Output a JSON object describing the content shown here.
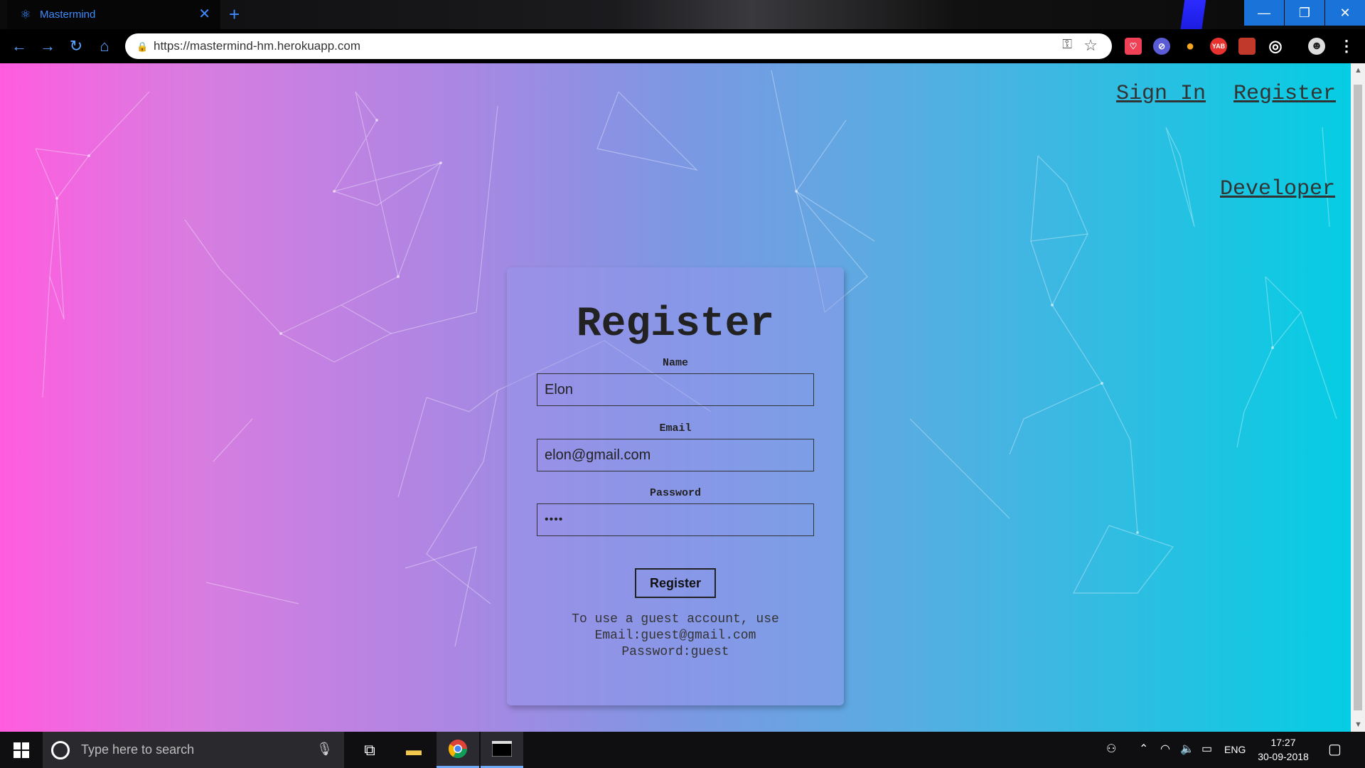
{
  "browser": {
    "tab_title": "Mastermind",
    "tab_close": "✕",
    "new_tab": "+",
    "url": "https://mastermind-hm.herokuapp.com",
    "window_controls": {
      "minimize": "—",
      "restore": "❐",
      "close": "✕"
    },
    "nav": {
      "back": "←",
      "forward": "→",
      "reload": "↻",
      "home": "⌂"
    },
    "extensions": [
      {
        "name": "pocket-icon",
        "glyph": "♡",
        "color": "#ef4056"
      },
      {
        "name": "block-icon",
        "glyph": "⊘",
        "color": "#5b5bd6"
      },
      {
        "name": "bulb-icon",
        "glyph": "●",
        "color": "#f5a623"
      },
      {
        "name": "yab-icon",
        "glyph": "YAB",
        "color": "#e8322f"
      },
      {
        "name": "bookmark-icon",
        "glyph": "▌",
        "color": "#c0392b"
      },
      {
        "name": "target-icon",
        "glyph": "◎",
        "color": "#222"
      },
      {
        "name": "profile-icon",
        "glyph": "☻",
        "color": "#ddd"
      },
      {
        "name": "menu-icon",
        "glyph": "⋮",
        "color": "#000"
      }
    ]
  },
  "nav_links": {
    "sign_in": "Sign In",
    "register": "Register",
    "developer": "Developer"
  },
  "form": {
    "title": "Register",
    "name_label": "Name",
    "name_value": "Elon",
    "email_label": "Email",
    "email_value": "elon@gmail.com",
    "password_label": "Password",
    "password_value": "••••",
    "submit_label": "Register",
    "guest_line1": "To use a guest account, use",
    "guest_line2": "Email:guest@gmail.com",
    "guest_line3": "Password:guest"
  },
  "taskbar": {
    "search_placeholder": "Type here to search",
    "language": "ENG",
    "time": "17:27",
    "date": "30-09-2018"
  }
}
